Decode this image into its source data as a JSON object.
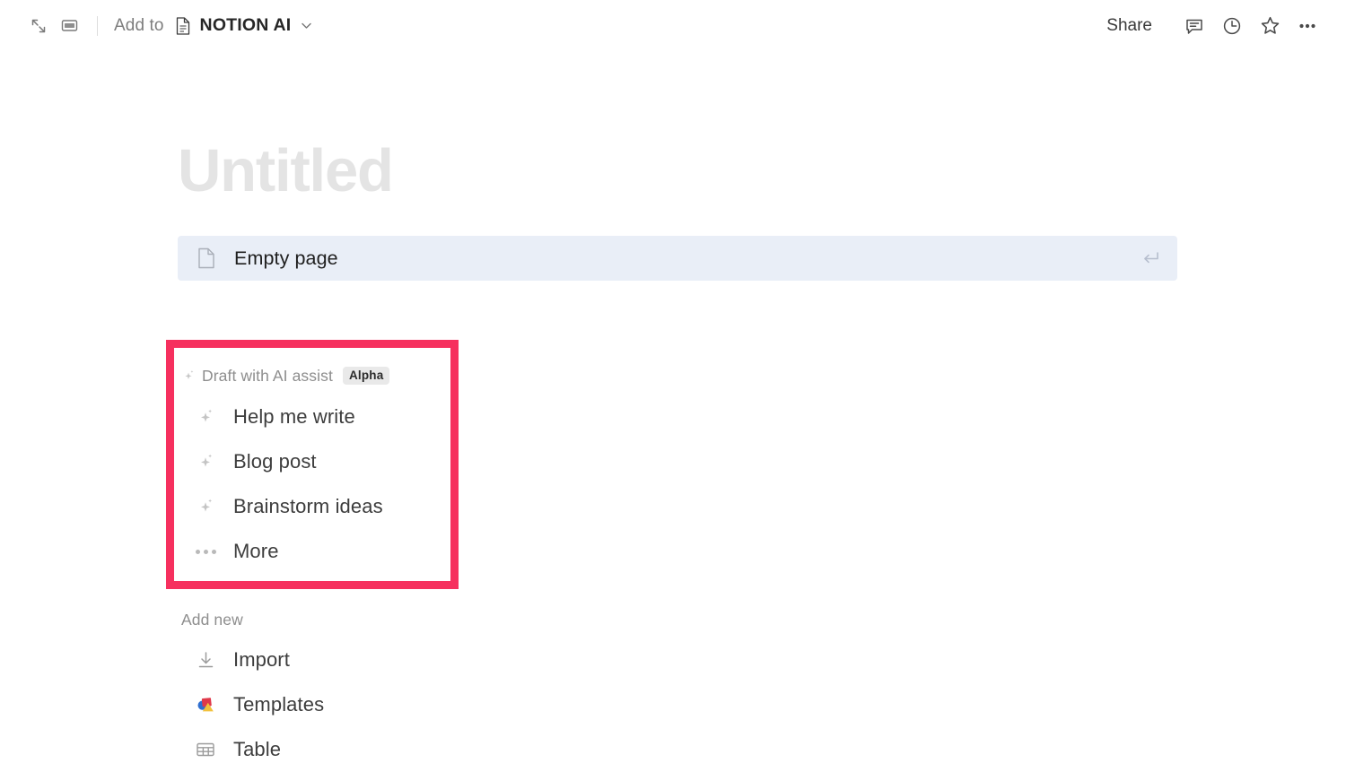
{
  "topbar": {
    "expand_icon": "expand-collapse-icon",
    "panel_icon": "sidebar-panel-icon",
    "add_to_label": "Add to",
    "doc_icon": "document-icon",
    "doc_title": "NOTION AI",
    "chevron_icon": "chevron-down-icon",
    "share_label": "Share",
    "comment_icon": "comment-icon",
    "history_icon": "clock-history-icon",
    "favorite_icon": "star-icon",
    "more_icon": "more-horizontal-icon"
  },
  "page": {
    "title_placeholder": "Untitled"
  },
  "empty_page_row": {
    "icon": "page-file-icon",
    "label": "Empty page",
    "enter_icon": "enter-return-icon"
  },
  "ai_section": {
    "icon": "sparkle-icon",
    "heading": "Draft with AI assist",
    "badge": "Alpha",
    "items": [
      {
        "icon": "sparkle-icon",
        "label": "Help me write"
      },
      {
        "icon": "sparkle-icon",
        "label": "Blog post"
      },
      {
        "icon": "sparkle-icon",
        "label": "Brainstorm ideas"
      },
      {
        "icon": "more-horizontal-icon",
        "label": "More"
      }
    ]
  },
  "add_new_section": {
    "heading": "Add new",
    "items": [
      {
        "icon": "import-download-icon",
        "label": "Import"
      },
      {
        "icon": "templates-shapes-icon",
        "label": "Templates"
      },
      {
        "icon": "table-grid-icon",
        "label": "Table"
      }
    ]
  },
  "colors": {
    "annotation_border": "#f6305e",
    "row_highlight": "#e9eef7",
    "badge_background": "#e9e9e9",
    "placeholder_text": "#e4e4e4",
    "templates_blue": "#2f6fd0",
    "templates_red": "#e0394a",
    "templates_yellow": "#f2c13c"
  }
}
